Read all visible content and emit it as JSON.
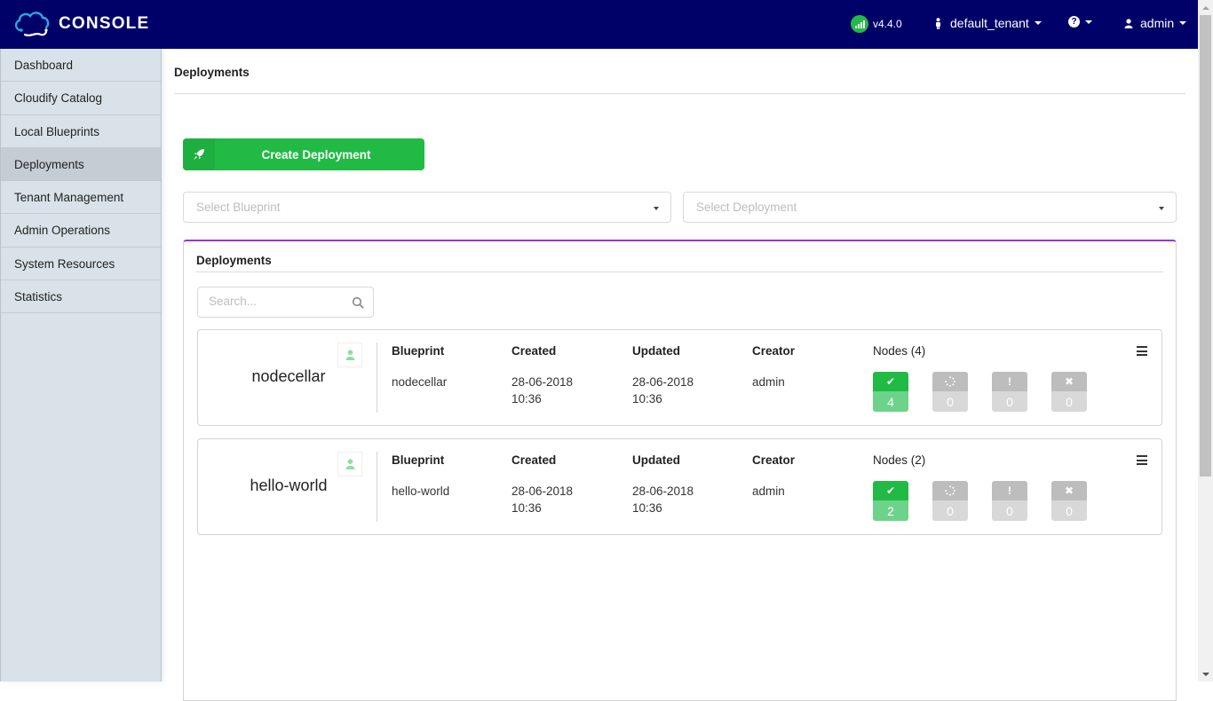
{
  "app": {
    "logo_text": "CONSOLE",
    "version": "v4.4.0",
    "tenant": "default_tenant",
    "help_symbol": "?",
    "user": "admin"
  },
  "colors": {
    "topbar": "#000069",
    "accent_green": "#21ba45",
    "widget_accent": "#a333c8",
    "sidebar_bg": "#d8e2e8"
  },
  "sidebar": {
    "items": [
      {
        "label": "Dashboard",
        "active": false
      },
      {
        "label": "Cloudify Catalog",
        "active": false
      },
      {
        "label": "Local Blueprints",
        "active": false
      },
      {
        "label": "Deployments",
        "active": true
      },
      {
        "label": "Tenant Management",
        "active": false
      },
      {
        "label": "Admin Operations",
        "active": false
      },
      {
        "label": "System Resources",
        "active": false
      },
      {
        "label": "Statistics",
        "active": false
      }
    ]
  },
  "page": {
    "title": "Deployments",
    "create_button": "Create Deployment",
    "create_icon": "rocket-icon",
    "select_blueprint_placeholder": "Select Blueprint",
    "select_deployment_placeholder": "Select Deployment"
  },
  "widget": {
    "title": "Deployments",
    "search_placeholder": "Search...",
    "columns": {
      "blueprint": "Blueprint",
      "created": "Created",
      "updated": "Updated",
      "creator": "Creator"
    },
    "deployments": [
      {
        "name": "nodecellar",
        "blueprint": "nodecellar",
        "created_date": "28-06-2018",
        "created_time": "10:36",
        "updated_date": "28-06-2018",
        "updated_time": "10:36",
        "creator": "admin",
        "nodes_label": "Nodes (4)",
        "nodes": {
          "started": "4",
          "in_progress": "0",
          "warning": "0",
          "failed": "0"
        }
      },
      {
        "name": "hello-world",
        "blueprint": "hello-world",
        "created_date": "28-06-2018",
        "created_time": "10:36",
        "updated_date": "28-06-2018",
        "updated_time": "10:36",
        "creator": "admin",
        "nodes_label": "Nodes (2)",
        "nodes": {
          "started": "2",
          "in_progress": "0",
          "warning": "0",
          "failed": "0"
        }
      }
    ]
  }
}
